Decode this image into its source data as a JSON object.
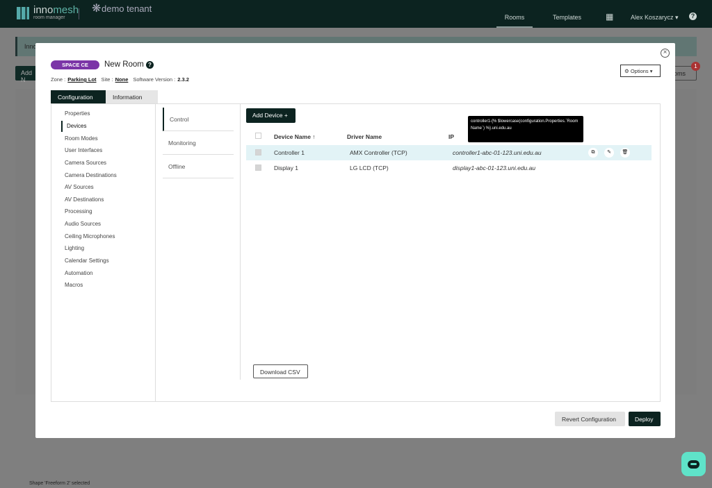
{
  "header": {
    "logo_name_a": "inno",
    "logo_name_b": "mesh",
    "logo_sub": "room manager",
    "tenant": "demo tenant",
    "nav": [
      "Rooms",
      "Templates"
    ],
    "user": "Alex Koszarycz ▾"
  },
  "background": {
    "banner_text": "Inno",
    "add_label": "Add N",
    "rooms_label": "ooms",
    "badge_count": "1",
    "status_text": "Shape 'Freeform 2' selected"
  },
  "modal": {
    "pill": "SPACE CE",
    "title": "New Room",
    "zone_label": "Zone :",
    "zone": "Parking Lot",
    "site_label": "Site :",
    "site": "None",
    "version_label": "Software Version :",
    "version": "2.3.2",
    "options_label": "Options",
    "tabs": [
      "Configuration",
      "Information"
    ],
    "left_nav": [
      "Properties",
      "Devices",
      "Room Modes",
      "User Interfaces",
      "Camera Sources",
      "Camera Destinations",
      "AV Sources",
      "AV Destinations",
      "Processing",
      "Audio Sources",
      "Ceiling Microphones",
      "Lighting",
      "Calendar Settings",
      "Automation",
      "Macros"
    ],
    "sub_nav": [
      "Control",
      "Monitoring",
      "Offline"
    ],
    "add_device": "Add Device +",
    "columns": {
      "device": "Device Name ↑",
      "driver": "Driver Name",
      "ip": "IP"
    },
    "rows": [
      {
        "device": "Controller 1",
        "driver": "AMX Controller (TCP)",
        "ip": "controller1-abc-01-123.uni.edu.au"
      },
      {
        "device": "Display 1",
        "driver": "LG LCD (TCP)",
        "ip": "display1-abc-01-123.uni.edu.au"
      }
    ],
    "tooltip": "controller1-{% $lowercase(configuration.Properties.`Room Name`) %}.uni.edu.au",
    "download_csv": "Download CSV",
    "revert": "Revert Configuration",
    "deploy": "Deploy"
  }
}
